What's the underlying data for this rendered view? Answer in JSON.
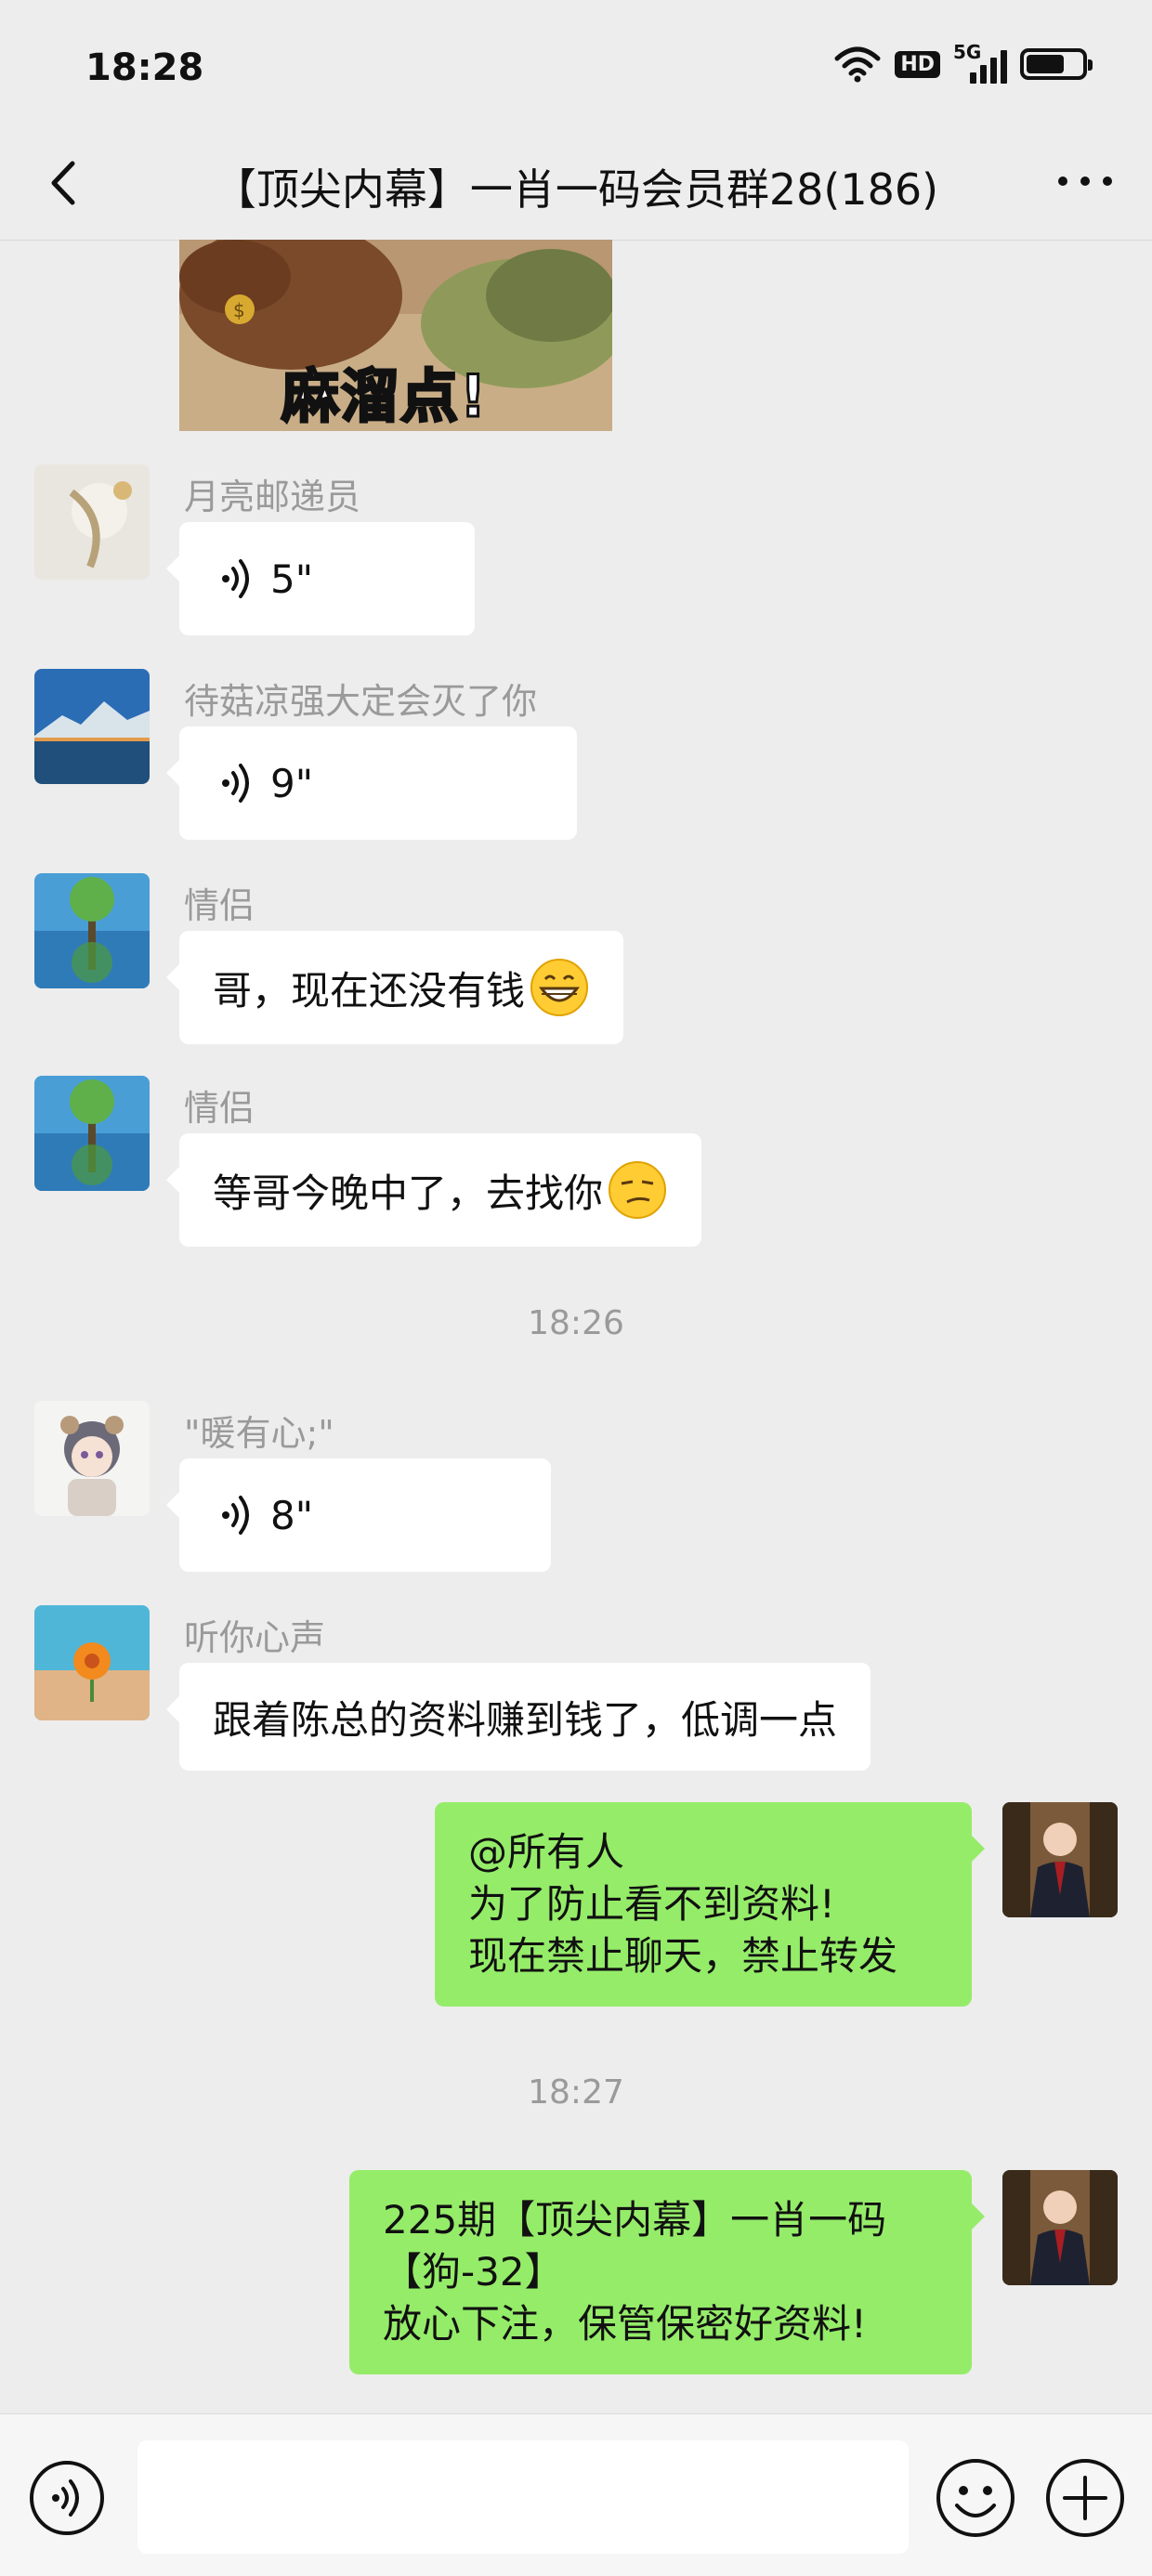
{
  "status_bar": {
    "time": "18:28",
    "hd_label": "HD",
    "network_label": "5G"
  },
  "header": {
    "title": "【顶尖内幕】一肖一码会员群28(186)"
  },
  "image_message": {
    "caption": "麻溜点!"
  },
  "messages": [
    {
      "nick": "月亮邮递员",
      "type": "voice",
      "duration": "5\""
    },
    {
      "nick": "待菇凉强大定会灭了你",
      "type": "voice",
      "duration": "9\""
    },
    {
      "nick": "情侣",
      "type": "text",
      "text": "哥，现在还没有钱",
      "emoji": "grinning-face"
    },
    {
      "nick": "情侣",
      "type": "text",
      "text": "等哥今晚中了，去找你",
      "emoji": "smirking-face"
    },
    {
      "nick": "\"暖有心;\"",
      "type": "voice",
      "duration": "8\""
    },
    {
      "nick": "听你心声",
      "type": "text",
      "text": "跟着陈总的资料赚到钱了，低调一点"
    }
  ],
  "timestamps": [
    "18:26",
    "18:27"
  ],
  "own_messages": [
    {
      "lines": [
        "@所有人",
        "为了防止看不到资料!",
        "现在禁止聊天，禁止转发"
      ]
    },
    {
      "lines": [
        "225期【顶尖内幕】一肖一码",
        "【狗-32】",
        "放心下注，保管保密好资料!"
      ]
    }
  ],
  "colors": {
    "own_bubble": "#95ec69",
    "background": "#ededed",
    "other_bubble": "#ffffff"
  }
}
